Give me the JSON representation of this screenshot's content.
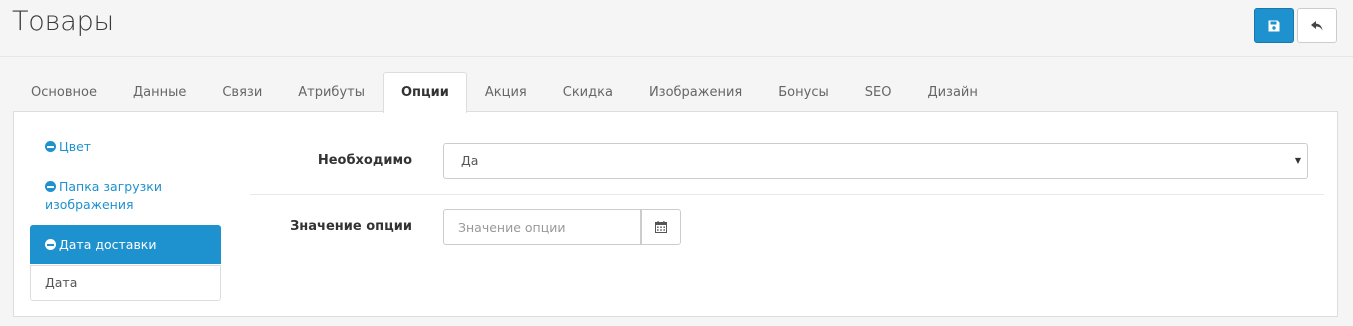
{
  "header": {
    "title": "Товары",
    "save_icon": "save-icon",
    "back_icon": "reply-icon"
  },
  "tabs": [
    {
      "label": "Основное"
    },
    {
      "label": "Данные"
    },
    {
      "label": "Связи"
    },
    {
      "label": "Атрибуты"
    },
    {
      "label": "Опции",
      "active": true
    },
    {
      "label": "Акция"
    },
    {
      "label": "Скидка"
    },
    {
      "label": "Изображения"
    },
    {
      "label": "Бонусы"
    },
    {
      "label": "SEO"
    },
    {
      "label": "Дизайн"
    }
  ],
  "options_list": {
    "items": [
      {
        "label": "Цвет"
      },
      {
        "label": "Папка загрузки изображения"
      },
      {
        "label": "Дата доставки"
      }
    ],
    "sub_item": "Дата"
  },
  "form": {
    "required_label": "Необходимо",
    "required_value": "Да",
    "option_value_label": "Значение опции",
    "option_value_placeholder": "Значение опции"
  },
  "colors": {
    "accent": "#1e91cf",
    "background": "#f5f5f5"
  }
}
